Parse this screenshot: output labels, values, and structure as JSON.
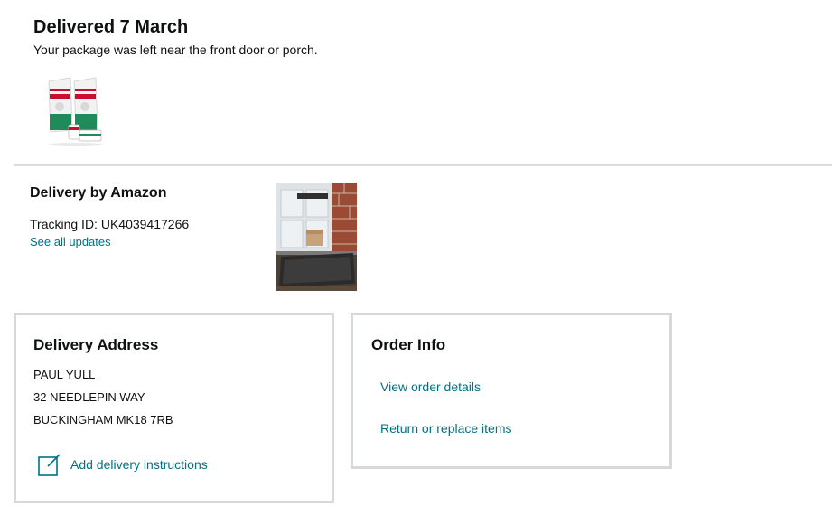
{
  "status": {
    "title": "Delivered 7 March",
    "subtitle": "Your package was left near the front door or porch."
  },
  "product": {
    "image_icon": "dog-food-product-image",
    "label": "ROYAL CANIN"
  },
  "delivery": {
    "title": "Delivery by Amazon",
    "tracking_label": "Tracking ID: UK4039417266",
    "see_all_updates": "See all updates",
    "photo_icon": "delivery-photo"
  },
  "address_card": {
    "title": "Delivery Address",
    "lines": [
      "PAUL YULL",
      "32 NEEDLEPIN WAY",
      "BUCKINGHAM MK18 7RB"
    ],
    "add_instructions": "Add delivery instructions",
    "add_instructions_icon": "edit-note-icon"
  },
  "order_info": {
    "title": "Order Info",
    "links": [
      "View order details",
      "Return or replace items"
    ]
  },
  "colors": {
    "link": "#007185",
    "text": "#0f1111",
    "border": "#d5d9d9"
  }
}
